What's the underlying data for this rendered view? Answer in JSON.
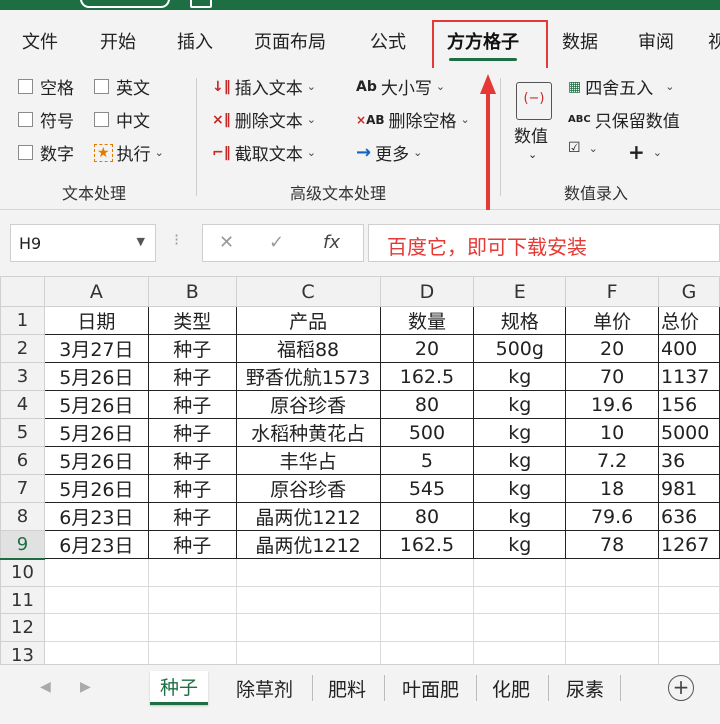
{
  "ribbon_tabs": [
    "文件",
    "开始",
    "插入",
    "页面布局",
    "公式",
    "方方格子",
    "数据",
    "审阅",
    "视"
  ],
  "ribbon": {
    "text_group": {
      "checkboxes": [
        "空格",
        "英文",
        "符号",
        "中文",
        "数字"
      ],
      "exec_label": "执行",
      "title": "文本处理"
    },
    "adv_group": {
      "insert_text": "插入文本",
      "delete_text": "删除文本",
      "extract_text": "截取文本",
      "case": "大小写",
      "delete_space": "删除空格",
      "more": "更多",
      "title": "高级文本处理"
    },
    "num_group": {
      "value_label": "数值",
      "round": "四舍五入",
      "keep_values": "只保留数值",
      "title": "数值录入"
    }
  },
  "formula_bar": {
    "name_box": "H9",
    "fx": "fx",
    "content": "百度它，即可下载安装"
  },
  "columns": [
    "A",
    "B",
    "C",
    "D",
    "E",
    "F",
    "G"
  ],
  "rows": [
    [
      "日期",
      "类型",
      "产品",
      "数量",
      "规格",
      "单价",
      "总价"
    ],
    [
      "3月27日",
      "种子",
      "福稻88",
      "20",
      "500g",
      "20",
      "400"
    ],
    [
      "5月26日",
      "种子",
      "野香优航1573",
      "162.5",
      "kg",
      "70",
      "1137"
    ],
    [
      "5月26日",
      "种子",
      "原谷珍香",
      "80",
      "kg",
      "19.6",
      "156"
    ],
    [
      "5月26日",
      "种子",
      "水稻种黄花占",
      "500",
      "kg",
      "10",
      "5000"
    ],
    [
      "5月26日",
      "种子",
      "丰华占",
      "5",
      "kg",
      "7.2",
      "36"
    ],
    [
      "5月26日",
      "种子",
      "原谷珍香",
      "545",
      "kg",
      "18",
      "981"
    ],
    [
      "6月23日",
      "种子",
      "晶两优1212",
      "80",
      "kg",
      "79.6",
      "636"
    ],
    [
      "6月23日",
      "种子",
      "晶两优1212",
      "162.5",
      "kg",
      "78",
      "1267"
    ],
    [
      "",
      "",
      "",
      "",
      "",
      "",
      ""
    ],
    [
      "",
      "",
      "",
      "",
      "",
      "",
      ""
    ],
    [
      "",
      "",
      "",
      "",
      "",
      "",
      ""
    ],
    [
      "",
      "",
      "",
      "",
      "",
      "",
      ""
    ]
  ],
  "row_numbers": [
    "1",
    "2",
    "3",
    "4",
    "5",
    "6",
    "7",
    "8",
    "9",
    "10",
    "11",
    "12",
    "13"
  ],
  "sheet_tabs": [
    "种子",
    "除草剂",
    "肥料",
    "叶面肥",
    "化肥",
    "尿素"
  ],
  "colors": {
    "accent": "#1e6e43",
    "highlight": "#e53935"
  }
}
